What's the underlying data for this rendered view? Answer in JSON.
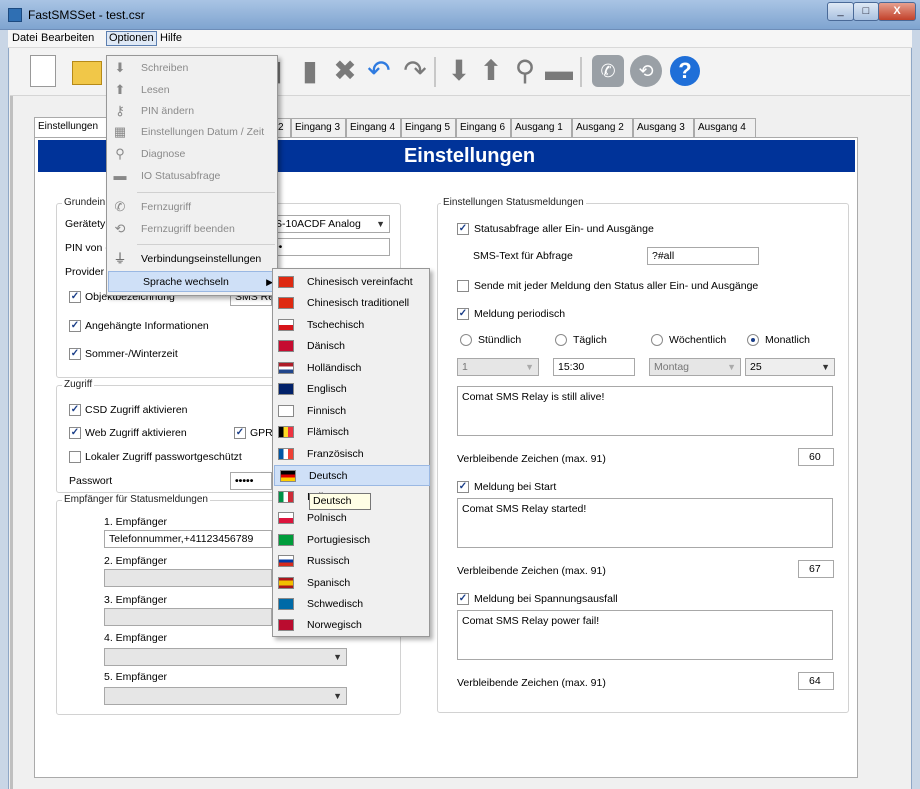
{
  "window": {
    "title": "FastSMSSet - test.csr",
    "buttons": {
      "minimize": "_",
      "maximize": "□",
      "close": "X"
    }
  },
  "menubar": [
    "Datei",
    "Bearbeiten",
    "Optionen",
    "Hilfe"
  ],
  "tabs": [
    "Einstellungen",
    "2",
    "Eingang 3",
    "Eingang 4",
    "Eingang 5",
    "Eingang 6",
    "Ausgang 1",
    "Ausgang 2",
    "Ausgang 3",
    "Ausgang 4"
  ],
  "header": "Einstellungen",
  "left": {
    "grundeinst_label": "Grundein",
    "geraetetyp_label": "Gerätety",
    "geraetetyp_value": "S-10ACDF Analog",
    "pin_label": "PIN von (",
    "pin_value": "••",
    "provider_label": "Provider",
    "objekt_label": "Objektbezeichnung",
    "objekt_value": "SMS Rel",
    "angehaengt_label": "Angehängte Informationen",
    "sommer_label": "Sommer-/Winterzeit",
    "zugriff_title": "Zugriff",
    "csd_label": "CSD Zugriff aktivieren",
    "web_label": "Web Zugriff aktivieren",
    "gpr_label": "GPR",
    "lokal_label": "Lokaler Zugriff passwortgeschützt",
    "passwort_label": "Passwort",
    "passwort_value": "•••••",
    "empf_title": "Empfänger für Statusmeldungen",
    "empfaenger": [
      {
        "label": "1. Empfänger",
        "value": "Telefonnummer,+41123456789"
      },
      {
        "label": "2. Empfänger",
        "value": ""
      },
      {
        "label": "3. Empfänger",
        "value": ""
      },
      {
        "label": "4. Empfänger",
        "value": ""
      },
      {
        "label": "5. Empfänger",
        "value": ""
      }
    ]
  },
  "right": {
    "title": "Einstellungen Statusmeldungen",
    "statusabfrage_label": "Statusabfrage aller Ein- und Ausgänge",
    "smstext_label": "SMS-Text für Abfrage",
    "smstext_value": "?#all",
    "sende_label": "Sende mit jeder Meldung den Status aller Ein- und Ausgänge",
    "periodisch_label": "Meldung periodisch",
    "radios": [
      "Stündlich",
      "Täglich",
      "Wöchentlich",
      "Monatlich"
    ],
    "hour_value": "1",
    "time_value": "15:30",
    "day_value": "Montag",
    "date_value": "25",
    "periodic_text": "Comat SMS Relay is still alive!",
    "remaining_label": "Verbleibende Zeichen (max. 91)",
    "remaining1": "60",
    "start_label": "Meldung bei Start",
    "start_text": "Comat SMS Relay started!",
    "remaining2": "67",
    "power_label": "Meldung bei Spannungsausfall",
    "power_text": "Comat SMS Relay power fail!",
    "remaining3": "64"
  },
  "optionen_menu": [
    "Schreiben",
    "Lesen",
    "PIN ändern",
    "Einstellungen Datum / Zeit",
    "Diagnose",
    "IO Statusabfrage",
    "Fernzugriff",
    "Fernzugriff beenden",
    "Verbindungseinstellungen",
    "Sprache wechseln"
  ],
  "sprache_menu": [
    "Chinesisch vereinfacht",
    "Chinesisch traditionell",
    "Tschechisch",
    "Dänisch",
    "Holländisch",
    "Englisch",
    "Finnisch",
    "Flämisch",
    "Französisch",
    "Deutsch",
    "Italienisch",
    "Polnisch",
    "Portugiesisch",
    "Russisch",
    "Spanisch",
    "Schwedisch",
    "Norwegisch"
  ],
  "sprache_visible": {
    "italienisch_visible": "Italie"
  },
  "tooltip": "Deutsch"
}
